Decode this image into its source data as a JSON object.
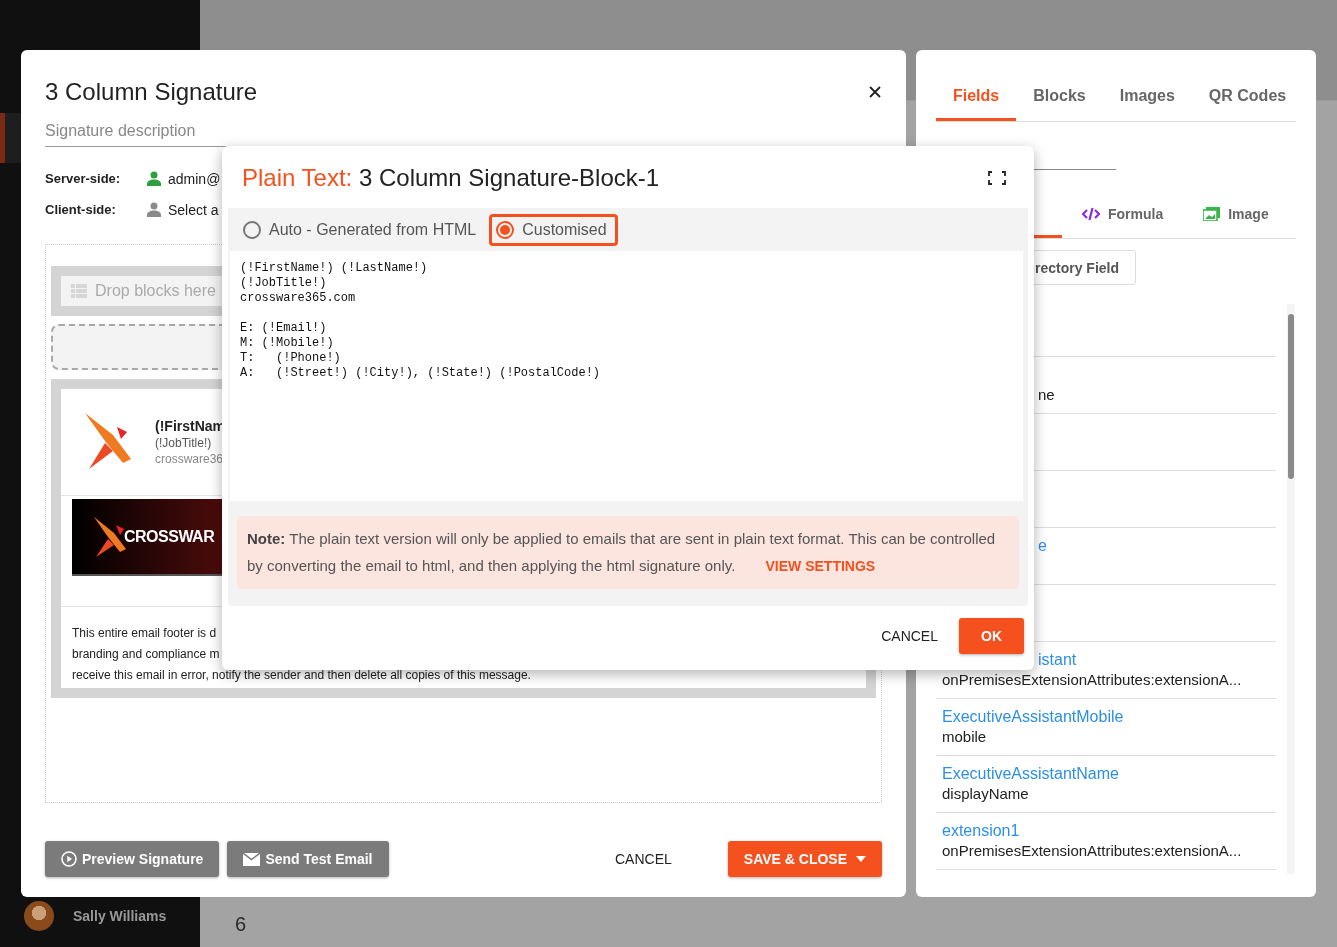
{
  "app": {
    "user_name": "Sally Williams",
    "row_number": "6"
  },
  "signature_dialog": {
    "title": "3 Column Signature",
    "description": {
      "placeholder": "Signature description"
    },
    "assignments": [
      {
        "label": "Server-side:",
        "value": "admin@",
        "kind": "assigned"
      },
      {
        "label": "Client-side:",
        "value": "Select a",
        "kind": "unassigned"
      }
    ],
    "drop_zone": "Drop blocks here",
    "signature_card": {
      "name": "(!FirstNam",
      "job_title": "(!JobTitle!)",
      "website": "crossware36"
    },
    "banner_logo": "CROSSWAR",
    "footer_lines": [
      "This entire email footer is d",
      "branding and compliance m",
      "receive this email in error, notify the sender and then delete all copies of this message."
    ],
    "buttons": [
      {
        "label": "Preview Signature",
        "kind": "preview"
      },
      {
        "label": "Send Test Email",
        "kind": "email"
      },
      {
        "label": "CANCEL",
        "kind": "text"
      },
      {
        "label": "SAVE & CLOSE",
        "kind": "primary-dropdown"
      }
    ]
  },
  "side_panel": {
    "tabs": [
      {
        "label": "Fields",
        "selected": true
      },
      {
        "label": "Blocks",
        "selected": false
      },
      {
        "label": "Images",
        "selected": false
      },
      {
        "label": "QR Codes",
        "selected": false
      }
    ],
    "field_types": [
      {
        "kind": "covered",
        "selected": true
      },
      {
        "label": "Formula",
        "kind": "formula",
        "selected": false
      },
      {
        "label": "Image",
        "kind": "image",
        "selected": false
      }
    ],
    "directory_button": "rectory Field",
    "fields": [
      {
        "kind": "covered"
      },
      {
        "kind": "covered",
        "value": "ne"
      },
      {
        "kind": "covered"
      },
      {
        "kind": "covered"
      },
      {
        "kind": "covered",
        "name": "e"
      },
      {
        "kind": "covered"
      },
      {
        "kind": "name-covered",
        "name": "istant",
        "value": "onPremisesExtensionAttributes:extensionA..."
      },
      {
        "kind": "full",
        "name": "ExecutiveAssistantMobile",
        "value": "mobile"
      },
      {
        "kind": "full",
        "name": "ExecutiveAssistantName",
        "value": "displayName"
      },
      {
        "kind": "full",
        "name": "extension1",
        "value": "onPremisesExtensionAttributes:extensionA..."
      }
    ]
  },
  "plain_text_dialog": {
    "title_prefix": "Plain Text:",
    "title": "3 Column Signature-Block-1",
    "modes": [
      {
        "label": "Auto - Generated from HTML",
        "selected": false
      },
      {
        "label": "Customised",
        "selected": true
      }
    ],
    "text_paragraphs": [
      [
        "(!FirstName!) (!LastName!)",
        "(!JobTitle!)",
        "crossware365.com"
      ],
      [
        "E: (!Email!)",
        "M: (!Mobile!)",
        "T:   (!Phone!)",
        "A:   (!Street!) (!City!), (!State!) (!PostalCode!)"
      ]
    ],
    "note": "**Note:** The plain text version will only be applied to emails that are sent in plain text format. This can be controlled by converting the email to html, and then applying the html signature only.",
    "note_link": "VIEW SETTINGS",
    "buttons": [
      {
        "label": "CANCEL",
        "kind": "text"
      },
      {
        "label": "OK",
        "kind": "primary"
      }
    ]
  }
}
